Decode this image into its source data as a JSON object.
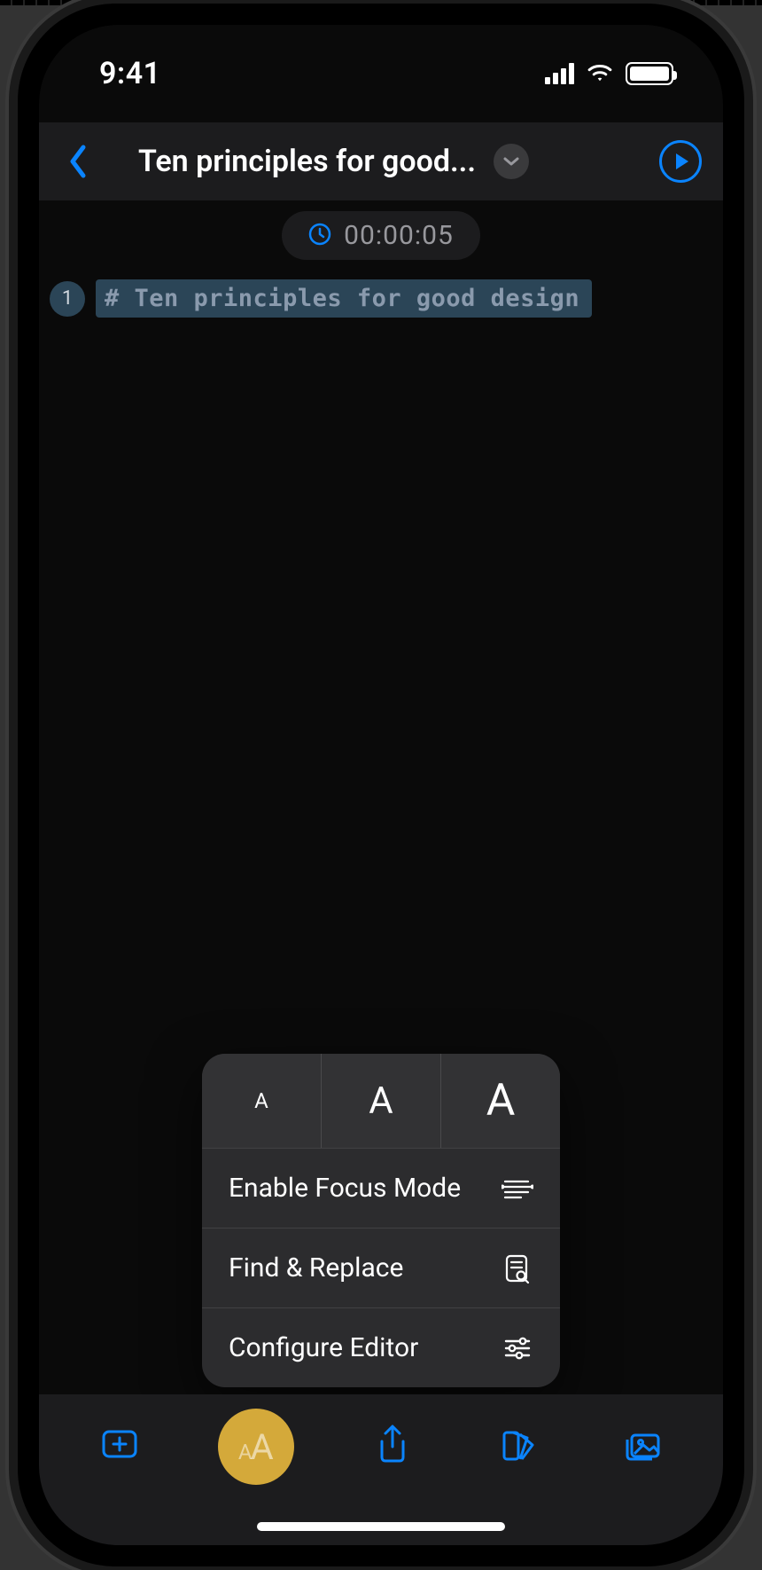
{
  "status": {
    "time": "9:41"
  },
  "nav": {
    "title": "Ten principles for good..."
  },
  "timer": {
    "value": "00:00:05"
  },
  "editor": {
    "lines": [
      {
        "num": "1",
        "text": "# Ten principles for good design"
      }
    ]
  },
  "popup": {
    "font_size_small": "A",
    "font_size_medium": "A",
    "font_size_large": "A",
    "items": [
      {
        "label": "Enable Focus Mode",
        "icon": "focus-mode-icon"
      },
      {
        "label": "Find & Replace",
        "icon": "find-replace-icon"
      },
      {
        "label": "Configure Editor",
        "icon": "sliders-icon"
      }
    ]
  },
  "toolbar": {
    "items": [
      {
        "name": "add-button",
        "icon": "plus-square-icon"
      },
      {
        "name": "text-appearance-button",
        "icon": "aa-icon",
        "active": true
      },
      {
        "name": "share-button",
        "icon": "share-icon"
      },
      {
        "name": "theme-button",
        "icon": "swatch-icon"
      },
      {
        "name": "gallery-button",
        "icon": "photos-icon"
      }
    ]
  },
  "colors": {
    "accent": "#0a84ff",
    "active_highlight": "#d4a93a"
  }
}
